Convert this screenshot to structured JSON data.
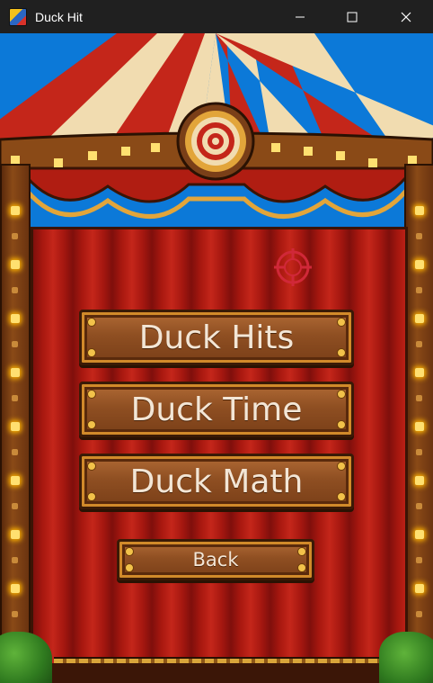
{
  "window": {
    "title": "Duck Hit",
    "app_icon": "duck-hit-app-icon",
    "controls": [
      "minimize-icon",
      "maximize-icon",
      "close-icon"
    ]
  },
  "menu": {
    "buttons": [
      {
        "label": "Duck Hits"
      },
      {
        "label": "Duck Time"
      },
      {
        "label": "Duck Math"
      }
    ],
    "back_label": "Back"
  },
  "scene": {
    "theme": "circus-tent",
    "cursor_icon": "crosshair-icon",
    "emblem_icon": "bullseye-target-icon",
    "colors": {
      "sky": "#0c79d8",
      "tent_red": "#c4261a",
      "tent_cream": "#f1dcb0",
      "wood": "#8f4f22",
      "crosshair": "#d02838",
      "button_text": "#f3e6d6"
    }
  }
}
